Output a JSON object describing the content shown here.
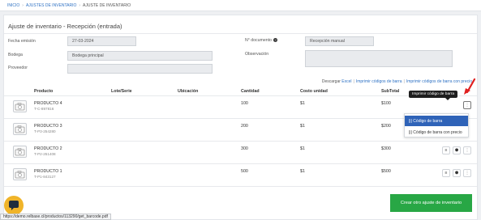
{
  "breadcrumb": {
    "home": "INICIO",
    "section": "AJUSTES DE INVENTARIO",
    "current": "AJUSTE DE INVENTARIO"
  },
  "page_title": "Ajuste de inventario - Recepción (entrada)",
  "form": {
    "fecha_label": "Fecha emisión",
    "fecha_value": "27-03-2024",
    "bodega_label": "Bodega",
    "bodega_value": "Bodega principal",
    "proveedor_label": "Proveedor",
    "proveedor_value": "",
    "documento_label": "N° documento",
    "documento_value": "Recepción manual",
    "observacion_label": "Observación",
    "observacion_value": ""
  },
  "links": {
    "prefix": "Descargar",
    "excel": "Excel",
    "barcodes": "Imprimir códigos de barra",
    "barcodes_price": "Imprimir códigos de barra con precio"
  },
  "table": {
    "headers": [
      "Producto",
      "Lote/Serie",
      "Ubicación",
      "Cantidad",
      "Costo unidad",
      "SubTotal"
    ],
    "rows": [
      {
        "name": "PRODUCTO 4",
        "code": "T-C-897816",
        "qty": "100",
        "cost": "$1",
        "subtotal": "$100"
      },
      {
        "name": "PRODUCTO 3",
        "code": "T-P3-254280",
        "qty": "200",
        "cost": "$1",
        "subtotal": "$200"
      },
      {
        "name": "PRODUCTO 2",
        "code": "T-P2-251408",
        "qty": "300",
        "cost": "$1",
        "subtotal": "$300"
      },
      {
        "name": "PRODUCTO 1",
        "code": "T-P1-843127",
        "qty": "500",
        "cost": "$1",
        "subtotal": "$500"
      }
    ]
  },
  "tooltip": "Imprimir código de barra",
  "menu": {
    "item1": "Código de barra",
    "item2": "Código de barra con precio"
  },
  "actions": {
    "more": "⋮",
    "list": "≡",
    "cube": "⬢",
    "barcode": "|||"
  },
  "create_button": "Crear otro ajuste de inventario",
  "status_url": "https://demo.relbase.cl/productos/113290/get_barcode.pdf",
  "colors": {
    "primary": "#2f72c4",
    "success": "#28a745",
    "menu_selected": "#2f63b8",
    "arrow": "#e02020",
    "chat": "#f0b429"
  }
}
